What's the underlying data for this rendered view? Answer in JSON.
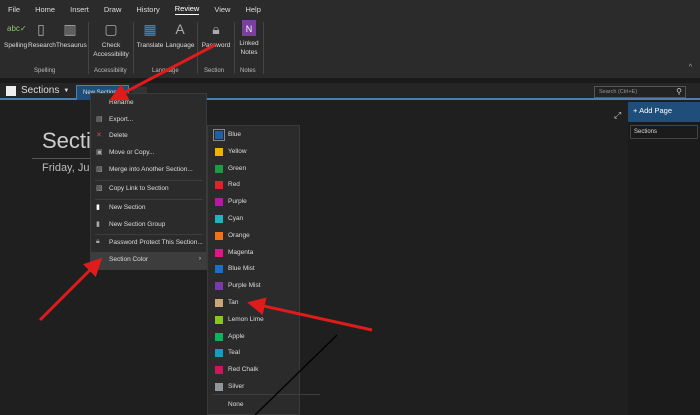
{
  "menu": [
    "File",
    "Home",
    "Insert",
    "Draw",
    "History",
    "Review",
    "View",
    "Help"
  ],
  "ribbon": {
    "buttons": [
      {
        "label": "Spelling",
        "icon": "abc-check-icon"
      },
      {
        "label": "Research",
        "icon": "research-icon"
      },
      {
        "label": "Thesaurus",
        "icon": "book-icon"
      },
      {
        "label": "Check Accessibility",
        "icon": "accessibility-icon"
      },
      {
        "label": "Translate",
        "icon": "translate-icon"
      },
      {
        "label": "Language",
        "icon": "language-icon"
      },
      {
        "label": "Password",
        "icon": "lock-icon"
      },
      {
        "label": "Linked Notes",
        "icon": "onenote-icon"
      }
    ],
    "groups": [
      "Spelling",
      "Accessibility",
      "Language",
      "Section",
      "Notes"
    ]
  },
  "notebook": {
    "name": "Sections",
    "tab": "New Section 1"
  },
  "search": {
    "placeholder": "Search (Ctrl+E)"
  },
  "page": {
    "title": "Sectio",
    "date": "Friday, Jun"
  },
  "pages_pane": {
    "add_page": "Add Page",
    "items": [
      "Sections"
    ]
  },
  "context_menu": [
    "Rename",
    "Export...",
    "Delete",
    "Move or Copy...",
    "Merge into Another Section...",
    "Copy Link to Section",
    "New Section",
    "New Section Group",
    "Password Protect This Section...",
    "Section Color"
  ],
  "colors": [
    {
      "label": "Blue",
      "hex": "#1f5fa8"
    },
    {
      "label": "Yellow",
      "hex": "#f0b400"
    },
    {
      "label": "Green",
      "hex": "#1f9a44"
    },
    {
      "label": "Red",
      "hex": "#e3212a"
    },
    {
      "label": "Purple",
      "hex": "#b41aa8"
    },
    {
      "label": "Cyan",
      "hex": "#1bb5c2"
    },
    {
      "label": "Orange",
      "hex": "#f07318"
    },
    {
      "label": "Magenta",
      "hex": "#e0158a"
    },
    {
      "label": "Blue Mist",
      "hex": "#1a6fc8"
    },
    {
      "label": "Purple Mist",
      "hex": "#7a3aad"
    },
    {
      "label": "Tan",
      "hex": "#c9a57a"
    },
    {
      "label": "Lemon Lime",
      "hex": "#8ac71e"
    },
    {
      "label": "Apple",
      "hex": "#12b05a"
    },
    {
      "label": "Teal",
      "hex": "#1a9ac2"
    },
    {
      "label": "Red Chalk",
      "hex": "#d0135c"
    },
    {
      "label": "Silver",
      "hex": "#8f979c"
    },
    {
      "label": "None",
      "hex": ""
    }
  ],
  "accent": "#1e4e79"
}
